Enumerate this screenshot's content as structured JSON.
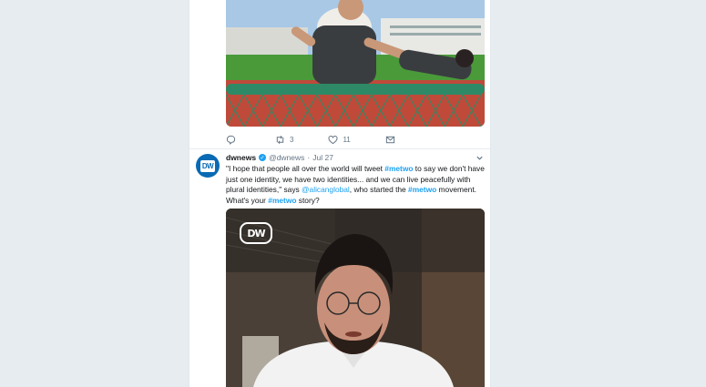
{
  "tweet1": {
    "actions": {
      "reply_count": "",
      "retweet_count": "3",
      "like_count": "11"
    }
  },
  "tweet2": {
    "display_name": "dwnews",
    "handle": "@dwnews",
    "separator": "·",
    "date": "Jul 27",
    "avatar_logo": "DW",
    "text_parts": {
      "p1": "\"I hope that people all over the world will tweet ",
      "tag1": "#metwo",
      "p2": " to say we don't have just one identity, we have two identities... and we can live peacefully with plural identities,\" says ",
      "mention": "@alicanglobal",
      "p3": ", who started the ",
      "tag2": "#metwo",
      "p4": " movement. What's your ",
      "tag3": "#metwo",
      "p5": " story?"
    },
    "video_badge": "DW"
  },
  "colors": {
    "accent": "#1da1f2",
    "page_bg": "#e6ecf0",
    "dw_blue": "#0a6ab3"
  }
}
